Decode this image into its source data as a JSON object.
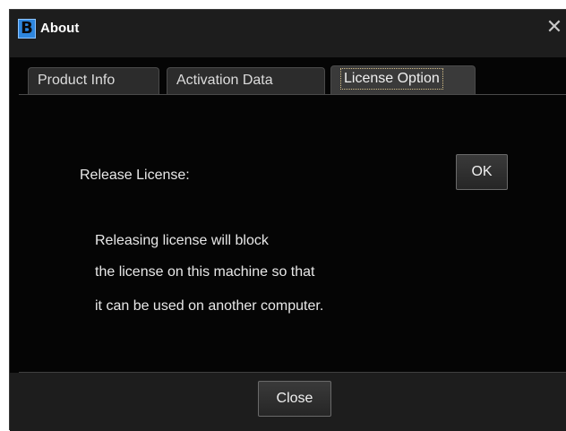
{
  "window": {
    "title": "About",
    "app_icon_letter": "B",
    "close_glyph": "✕",
    "icon": "app-logo-icon"
  },
  "tabs": [
    {
      "label": "Product Info",
      "selected": false
    },
    {
      "label": "Activation Data",
      "selected": false
    },
    {
      "label": "License Option",
      "selected": true
    }
  ],
  "license": {
    "release_label": "Release License:",
    "ok_label": "OK",
    "description_lines": [
      "Releasing license will block",
      "the license on this machine so that",
      "it can be used on another computer."
    ]
  },
  "footer": {
    "close_label": "Close"
  },
  "colors": {
    "background": "#050505",
    "titlebar": "#1d1d1d",
    "icon_blue": "#2e86de",
    "text": "#e8e8e8"
  }
}
